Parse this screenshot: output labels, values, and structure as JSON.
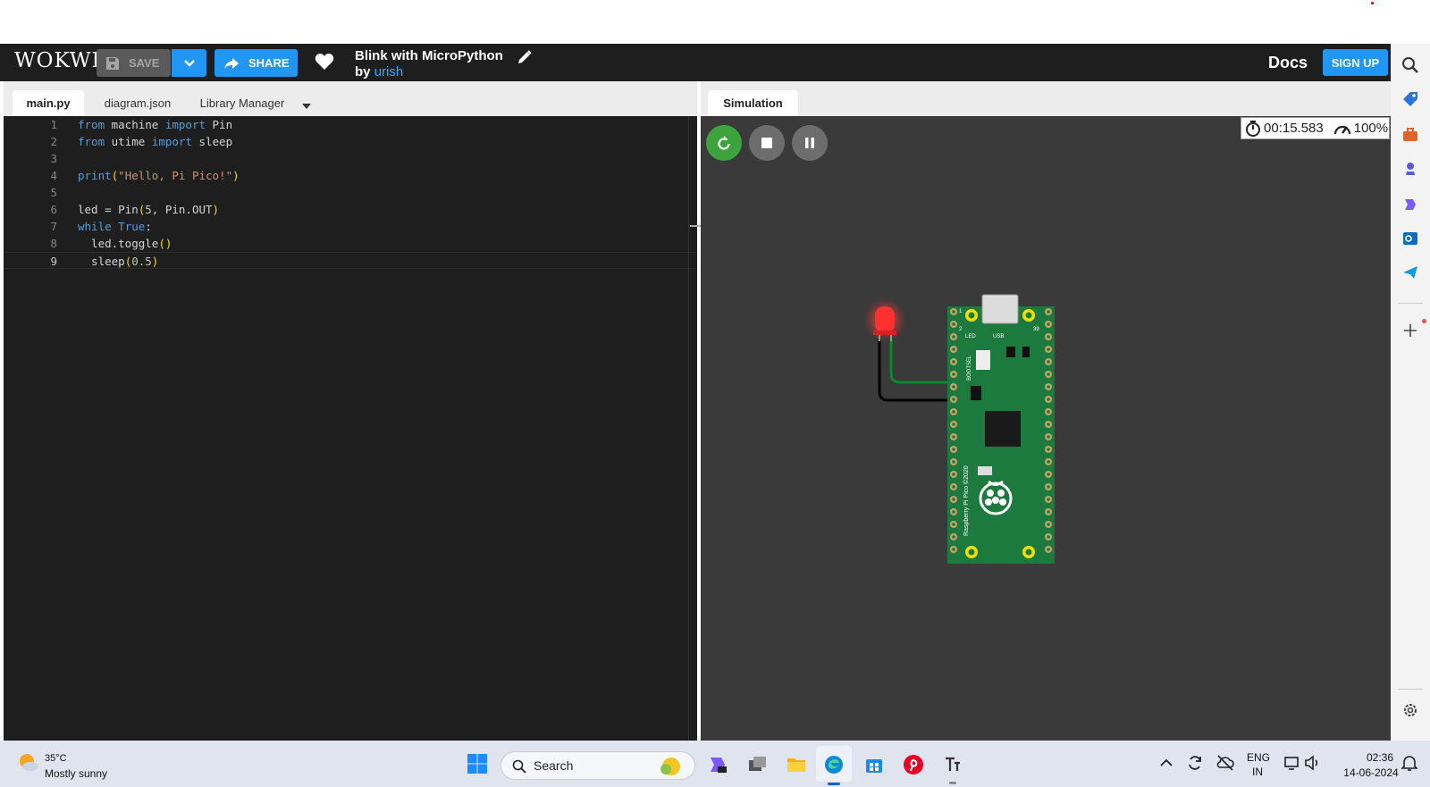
{
  "header": {
    "logo": "WOKWI",
    "save_label": "SAVE",
    "share_label": "SHARE",
    "project_title": "Blink with MicroPython",
    "by_prefix": "by",
    "author": "urish",
    "docs_label": "Docs",
    "signup_label": "SIGN UP"
  },
  "editor": {
    "tabs": [
      {
        "label": "main.py",
        "active": true
      },
      {
        "label": "diagram.json",
        "active": false
      },
      {
        "label": "Library Manager",
        "active": false
      }
    ],
    "current_line": 9,
    "lines": [
      {
        "num": "1",
        "text": "from machine import Pin"
      },
      {
        "num": "2",
        "text": "from utime import sleep"
      },
      {
        "num": "3",
        "text": ""
      },
      {
        "num": "4",
        "text": "print(\"Hello, Pi Pico!\")"
      },
      {
        "num": "5",
        "text": ""
      },
      {
        "num": "6",
        "text": "led = Pin(5, Pin.OUT)"
      },
      {
        "num": "7",
        "text": "while True:"
      },
      {
        "num": "8",
        "text": "  led.toggle()"
      },
      {
        "num": "9",
        "text": "  sleep(0.5)"
      }
    ]
  },
  "simulation": {
    "tab_label": "Simulation",
    "elapsed_time": "00:15.583",
    "speed": "100%",
    "board_labels": {
      "led": "LED",
      "usb": "USB",
      "bootsel": "BOOTSEL",
      "pin1": "1",
      "pin2": "2",
      "pin39": "39",
      "silkscreen": "Raspberry Pi Pico ©2020"
    },
    "led_color": "#ff3030",
    "wire_signal_color": "#0a8a2a",
    "wire_ground_color": "#000000"
  },
  "colors": {
    "accent": "#2196f3",
    "run_button": "#3da33d",
    "editor_bg": "#1e1e1e",
    "sim_bg": "#3a3a3a",
    "pcb": "#1c7a3e"
  },
  "taskbar": {
    "temperature": "35°C",
    "weather": "Mostly sunny",
    "search_label": "Search",
    "lang_top": "ENG",
    "lang_bottom": "IN",
    "time": "02:36",
    "date": "14-06-2024"
  }
}
